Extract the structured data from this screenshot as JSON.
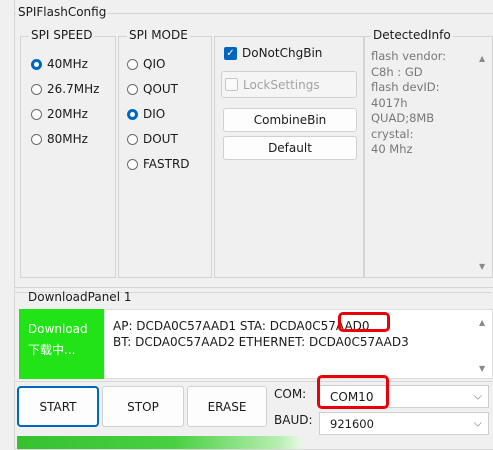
{
  "window": {
    "title": "SPIFlashConfig"
  },
  "spi_speed": {
    "title": "SPI SPEED",
    "options": [
      {
        "label": "40MHz",
        "selected": true
      },
      {
        "label": "26.7MHz",
        "selected": false
      },
      {
        "label": "20MHz",
        "selected": false
      },
      {
        "label": "80MHz",
        "selected": false
      }
    ]
  },
  "spi_mode": {
    "title": "SPI MODE",
    "options": [
      {
        "label": "QIO",
        "selected": false
      },
      {
        "label": "QOUT",
        "selected": false
      },
      {
        "label": "DIO",
        "selected": true
      },
      {
        "label": "DOUT",
        "selected": false
      },
      {
        "label": "FASTRD",
        "selected": false
      }
    ]
  },
  "options": {
    "do_not_chg_bin": {
      "label": "DoNotChgBin",
      "checked": true
    },
    "lock_settings": {
      "label": "LockSettings",
      "checked": false,
      "enabled": false
    },
    "combine_bin_label": "CombineBin",
    "default_label": "Default"
  },
  "detected_info": {
    "title": "DetectedInfo",
    "lines": [
      "flash vendor:",
      "C8h : GD",
      "flash devID:",
      "4017h",
      "QUAD;8MB",
      "crystal:",
      "40 Mhz"
    ]
  },
  "download_panel": {
    "title": "DownloadPanel 1",
    "status_line1": "Download",
    "status_line2": "下载中...",
    "status_color": "#22e317",
    "mac_line1": "AP:  DCDA0C57AAD1  STA:  DCDA0C57AAD0",
    "mac_line2": "BT:  DCDA0C57AAD2  ETHERNET:  DCDA0C57AAD3"
  },
  "controls": {
    "start_label": "START",
    "stop_label": "STOP",
    "erase_label": "ERASE",
    "com_label": "COM:",
    "com_value": "COM10",
    "baud_label": "BAUD:",
    "baud_value": "921600"
  },
  "progress": {
    "color": "#3ec83b"
  },
  "annotation": {
    "highlight_color": "#e8000b"
  }
}
